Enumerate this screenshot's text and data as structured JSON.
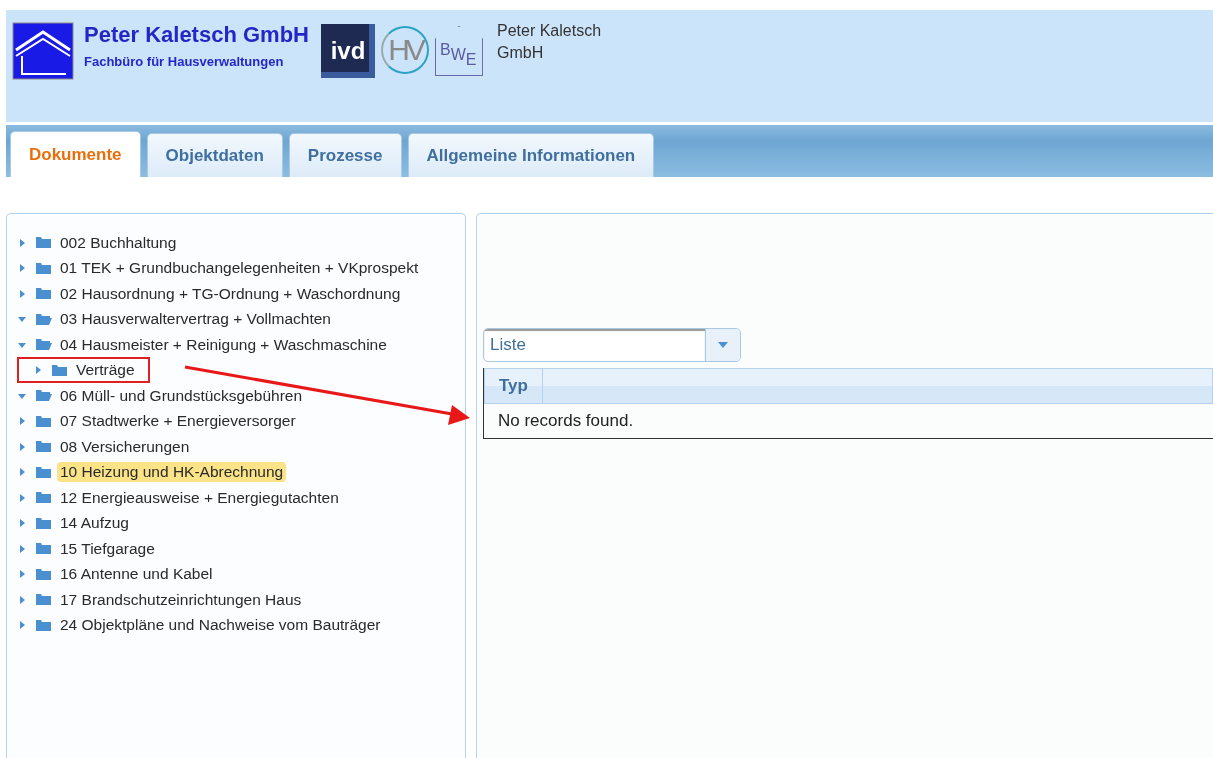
{
  "header": {
    "company": "Peter Kaletsch GmbH",
    "subtitle": "Fachbüro für Hausverwaltungen",
    "logos": [
      {
        "kind": "ivd",
        "text": "ivd"
      },
      {
        "kind": "hv",
        "text": "HV"
      },
      {
        "kind": "bwe",
        "text": "BWE"
      }
    ],
    "user": "Peter Kaletsch GmbH"
  },
  "tabs": [
    {
      "label": "Dokumente",
      "selected": true
    },
    {
      "label": "Objektdaten",
      "selected": false
    },
    {
      "label": "Prozesse",
      "selected": false
    },
    {
      "label": "Allgemeine Informationen",
      "selected": false
    }
  ],
  "tree": [
    {
      "label": "002 Buchhaltung",
      "expanded": false,
      "selected": false
    },
    {
      "label": "01 TEK + Grundbuchangelegenheiten + VKprospekt",
      "expanded": false,
      "selected": false
    },
    {
      "label": "02 Hausordnung + TG-Ordnung + Waschordnung",
      "expanded": false,
      "selected": false
    },
    {
      "label": "03 Hausverwaltervertrag + Vollmachten",
      "expanded": true,
      "selected": false
    },
    {
      "label": "04 Hausmeister + Reinigung + Waschmaschine",
      "expanded": true,
      "selected": false,
      "children": [
        {
          "label": "Verträge",
          "expanded": false,
          "selected": false,
          "marked": true
        }
      ]
    },
    {
      "label": "06 Müll- und Grundstücksgebühren",
      "expanded": true,
      "selected": false
    },
    {
      "label": "07 Stadtwerke + Energieversorger",
      "expanded": false,
      "selected": false
    },
    {
      "label": "08 Versicherungen",
      "expanded": false,
      "selected": false
    },
    {
      "label": "10 Heizung und HK-Abrechnung",
      "expanded": false,
      "selected": true
    },
    {
      "label": "12 Energieausweise + Energiegutachten",
      "expanded": false,
      "selected": false
    },
    {
      "label": "14 Aufzug",
      "expanded": false,
      "selected": false
    },
    {
      "label": "15 Tiefgarage",
      "expanded": false,
      "selected": false
    },
    {
      "label": "16 Antenne und Kabel",
      "expanded": false,
      "selected": false
    },
    {
      "label": "17 Brandschutzeinrichtungen Haus",
      "expanded": false,
      "selected": false
    },
    {
      "label": "24 Objektpläne und Nachweise vom Bauträger",
      "expanded": false,
      "selected": false
    }
  ],
  "view_select": {
    "value": "Liste"
  },
  "table": {
    "columns": [
      "Typ"
    ],
    "empty_message": "No records found."
  }
}
